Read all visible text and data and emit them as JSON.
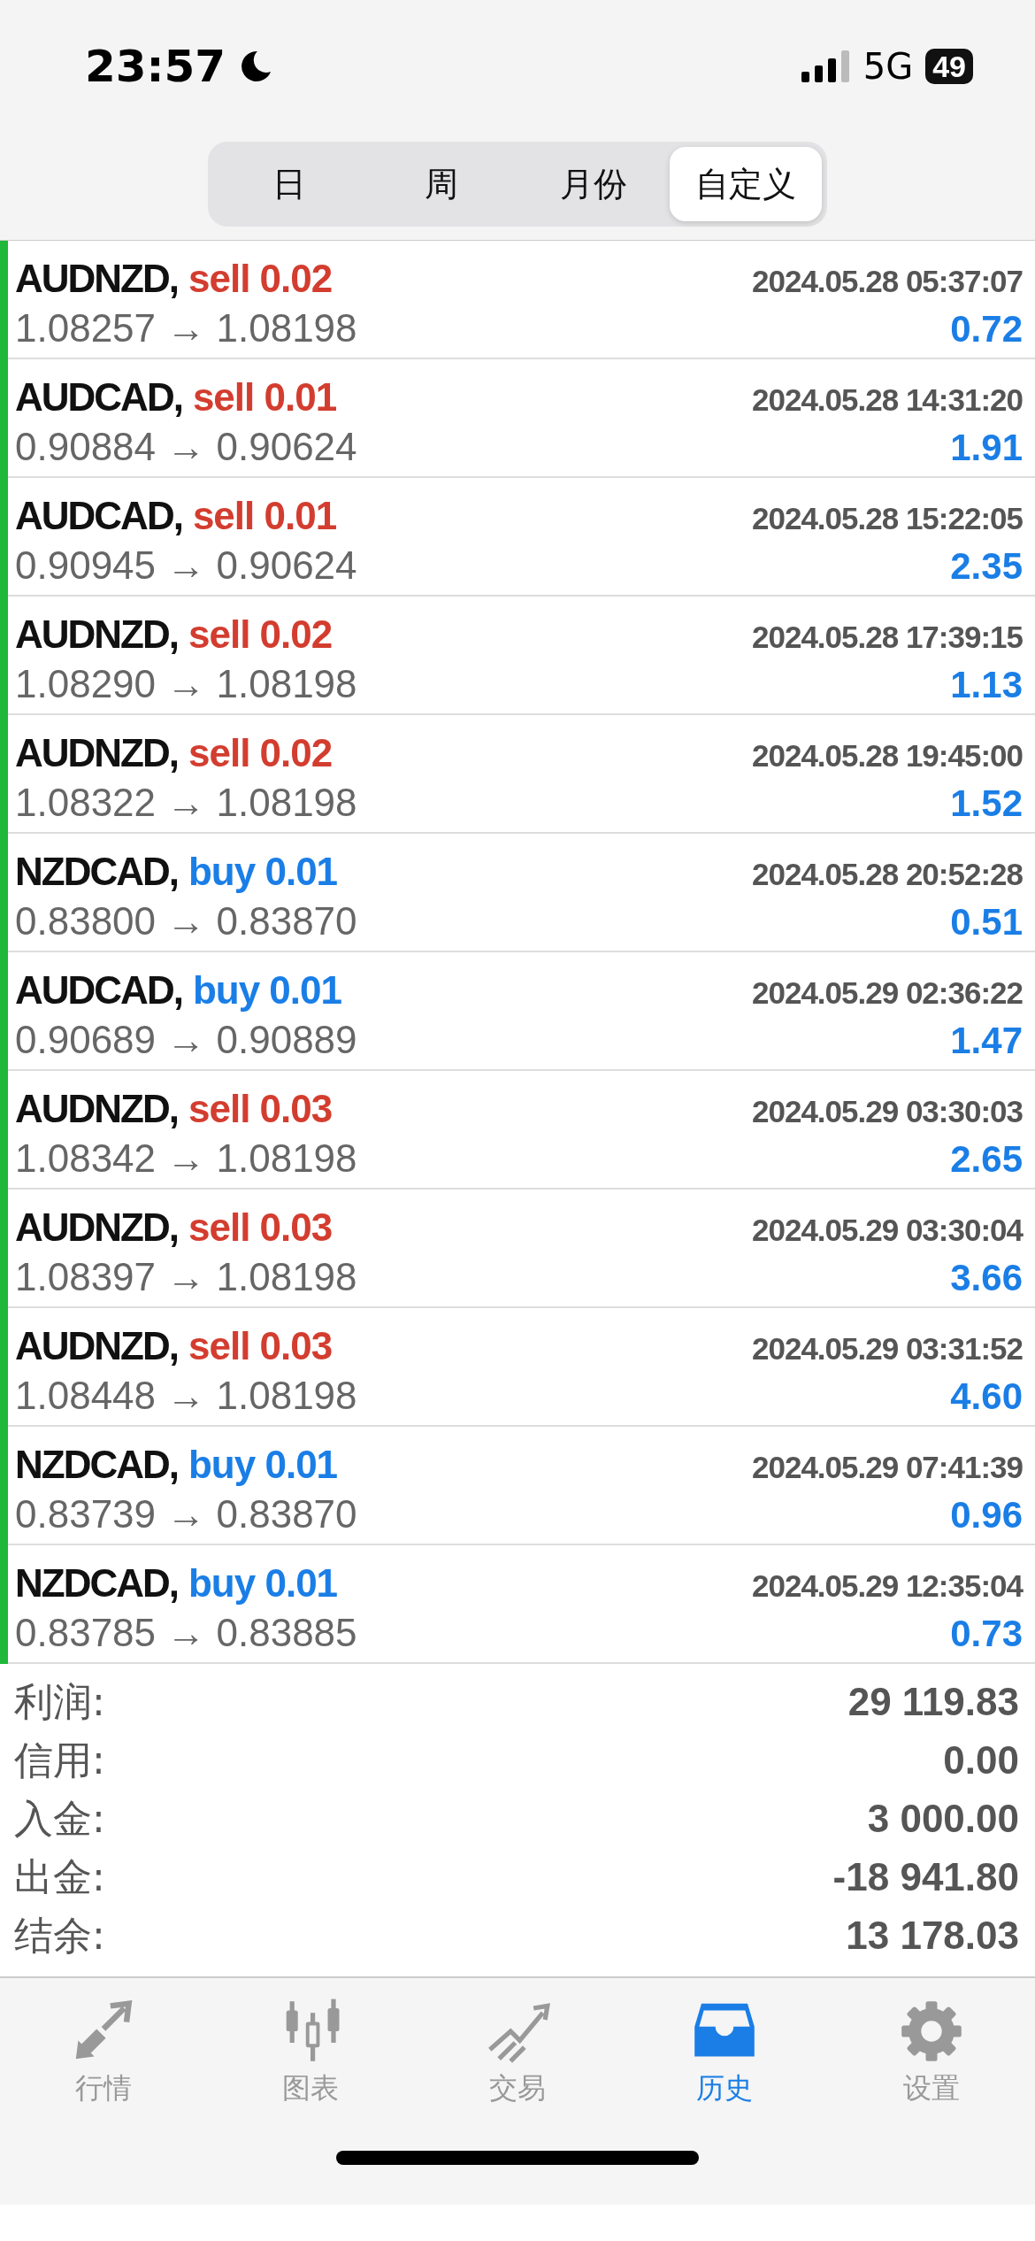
{
  "status_bar": {
    "time": "23:57",
    "network": "5G",
    "battery": "49"
  },
  "period_tabs": [
    {
      "label": "日",
      "selected": false
    },
    {
      "label": "周",
      "selected": false
    },
    {
      "label": "月份",
      "selected": false
    },
    {
      "label": "自定义",
      "selected": true
    }
  ],
  "deals": [
    {
      "symbol": "AUDNZD,",
      "kind": "sell",
      "side": "sell",
      "volume": "0.02",
      "time": "2024.05.28 05:37:07",
      "prices": "1.08257 → 1.08198",
      "profit": "0.72"
    },
    {
      "symbol": "AUDCAD,",
      "kind": "sell",
      "side": "sell",
      "volume": "0.01",
      "time": "2024.05.28 14:31:20",
      "prices": "0.90884 → 0.90624",
      "profit": "1.91"
    },
    {
      "symbol": "AUDCAD,",
      "kind": "sell",
      "side": "sell",
      "volume": "0.01",
      "time": "2024.05.28 15:22:05",
      "prices": "0.90945 → 0.90624",
      "profit": "2.35"
    },
    {
      "symbol": "AUDNZD,",
      "kind": "sell",
      "side": "sell",
      "volume": "0.02",
      "time": "2024.05.28 17:39:15",
      "prices": "1.08290 → 1.08198",
      "profit": "1.13"
    },
    {
      "symbol": "AUDNZD,",
      "kind": "sell",
      "side": "sell",
      "volume": "0.02",
      "time": "2024.05.28 19:45:00",
      "prices": "1.08322 → 1.08198",
      "profit": "1.52"
    },
    {
      "symbol": "NZDCAD,",
      "kind": "buy",
      "side": "buy",
      "volume": "0.01",
      "time": "2024.05.28 20:52:28",
      "prices": "0.83800 → 0.83870",
      "profit": "0.51"
    },
    {
      "symbol": "AUDCAD,",
      "kind": "buy",
      "side": "buy",
      "volume": "0.01",
      "time": "2024.05.29 02:36:22",
      "prices": "0.90689 → 0.90889",
      "profit": "1.47"
    },
    {
      "symbol": "AUDNZD,",
      "kind": "sell",
      "side": "sell",
      "volume": "0.03",
      "time": "2024.05.29 03:30:03",
      "prices": "1.08342 → 1.08198",
      "profit": "2.65"
    },
    {
      "symbol": "AUDNZD,",
      "kind": "sell",
      "side": "sell",
      "volume": "0.03",
      "time": "2024.05.29 03:30:04",
      "prices": "1.08397 → 1.08198",
      "profit": "3.66"
    },
    {
      "symbol": "AUDNZD,",
      "kind": "sell",
      "side": "sell",
      "volume": "0.03",
      "time": "2024.05.29 03:31:52",
      "prices": "1.08448 → 1.08198",
      "profit": "4.60"
    },
    {
      "symbol": "NZDCAD,",
      "kind": "buy",
      "side": "buy",
      "volume": "0.01",
      "time": "2024.05.29 07:41:39",
      "prices": "0.83739 → 0.83870",
      "profit": "0.96"
    },
    {
      "symbol": "NZDCAD,",
      "kind": "buy",
      "side": "buy",
      "volume": "0.01",
      "time": "2024.05.29 12:35:04",
      "prices": "0.83785 → 0.83885",
      "profit": "0.73"
    }
  ],
  "summary": [
    {
      "label": "利润:",
      "value": "29 119.83"
    },
    {
      "label": "信用:",
      "value": "0.00"
    },
    {
      "label": "入金:",
      "value": "3 000.00"
    },
    {
      "label": "出金:",
      "value": "-18 941.80"
    },
    {
      "label": "结余:",
      "value": "13 178.03"
    }
  ],
  "tab_bar": [
    {
      "kind": "quotes",
      "label": "行情",
      "selected": false
    },
    {
      "kind": "chart",
      "label": "图表",
      "selected": false
    },
    {
      "kind": "trade",
      "label": "交易",
      "selected": false
    },
    {
      "kind": "history",
      "label": "历史",
      "selected": true
    },
    {
      "kind": "settings",
      "label": "设置",
      "selected": false
    }
  ]
}
